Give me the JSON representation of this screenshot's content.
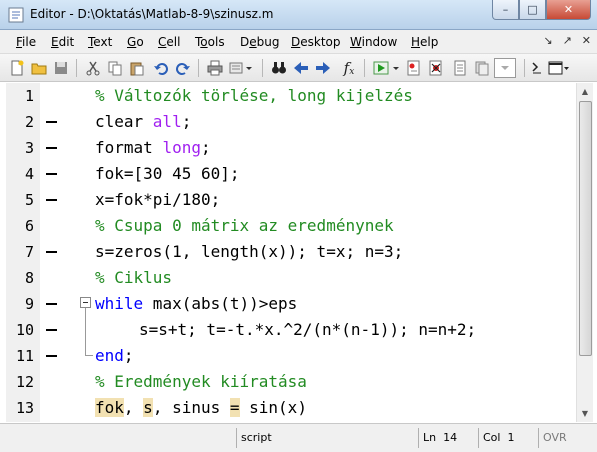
{
  "window": {
    "title": "Editor - D:\\Oktatás\\Matlab-8-9\\szinusz.m",
    "buttons": {
      "minimize": "–",
      "maximize": "□",
      "close": "✕"
    }
  },
  "menubar": {
    "items": [
      {
        "label": "File"
      },
      {
        "label": "Edit"
      },
      {
        "label": "Text"
      },
      {
        "label": "Go"
      },
      {
        "label": "Cell"
      },
      {
        "label": "Tools"
      },
      {
        "label": "Debug"
      },
      {
        "label": "Desktop"
      },
      {
        "label": "Window"
      },
      {
        "label": "Help"
      }
    ],
    "right_glyphs": [
      "↘",
      "↗",
      "✕"
    ]
  },
  "toolbar": {
    "icons": [
      "new-file-icon",
      "open-folder-icon",
      "save-icon",
      "cut-icon",
      "copy-icon",
      "paste-icon",
      "undo-icon",
      "redo-icon",
      "print-icon",
      "find-files-icon",
      "binoculars-icon",
      "back-icon",
      "forward-icon",
      "function-icon",
      "run-icon",
      "step-icon",
      "clear-breakpoints-icon",
      "stop-icon",
      "stack-icon",
      "dock-icon"
    ],
    "fx_label": "f",
    "fx_sub": "x"
  },
  "editor": {
    "lines": [
      {
        "n": "1",
        "dash": false,
        "segments": [
          {
            "t": "% Változók törlése, long kijelzés",
            "c": "comment"
          }
        ]
      },
      {
        "n": "2",
        "dash": true,
        "segments": [
          {
            "t": "clear ",
            "c": ""
          },
          {
            "t": "all",
            "c": "string"
          },
          {
            "t": ";",
            "c": ""
          }
        ]
      },
      {
        "n": "3",
        "dash": true,
        "segments": [
          {
            "t": "format ",
            "c": ""
          },
          {
            "t": "long",
            "c": "string"
          },
          {
            "t": ";",
            "c": ""
          }
        ]
      },
      {
        "n": "4",
        "dash": true,
        "segments": [
          {
            "t": "fok=[30 45 60];",
            "c": ""
          }
        ]
      },
      {
        "n": "5",
        "dash": true,
        "segments": [
          {
            "t": "x=fok*pi/180;",
            "c": ""
          }
        ]
      },
      {
        "n": "6",
        "dash": false,
        "segments": [
          {
            "t": "% Csupa 0 mátrix az eredménynek",
            "c": "comment"
          }
        ]
      },
      {
        "n": "7",
        "dash": true,
        "segments": [
          {
            "t": "s=zeros(1, length(x)); t=x; n=3;",
            "c": ""
          }
        ]
      },
      {
        "n": "8",
        "dash": false,
        "segments": [
          {
            "t": "% Ciklus",
            "c": "comment"
          }
        ]
      },
      {
        "n": "9",
        "dash": true,
        "segments": [
          {
            "t": "while",
            "c": "keyword"
          },
          {
            "t": " max(abs(t))>eps",
            "c": ""
          }
        ]
      },
      {
        "n": "10",
        "dash": true,
        "indent": true,
        "segments": [
          {
            "t": "s=s+t; t=-t.*x.^2/(n*(n-1)); n=n+2;",
            "c": ""
          }
        ]
      },
      {
        "n": "11",
        "dash": true,
        "segments": [
          {
            "t": "end",
            "c": "keyword"
          },
          {
            "t": ";",
            "c": ""
          }
        ]
      },
      {
        "n": "12",
        "dash": false,
        "segments": [
          {
            "t": "% Eredmények kiíratása",
            "c": "comment"
          }
        ]
      },
      {
        "n": "13",
        "dash": false,
        "segments": [
          {
            "t": "fok",
            "c": "hl"
          },
          {
            "t": ", ",
            "c": ""
          },
          {
            "t": "s",
            "c": "hl"
          },
          {
            "t": ", sinus ",
            "c": ""
          },
          {
            "t": "=",
            "c": "hl"
          },
          {
            "t": " sin(x)",
            "c": ""
          }
        ]
      }
    ]
  },
  "statusbar": {
    "mode": "script",
    "ln_label": "Ln",
    "ln_value": "14",
    "col_label": "Col",
    "col_value": "1",
    "ovr": "OVR"
  },
  "colors": {
    "comment": "#228b22",
    "keyword": "#0000ff",
    "string": "#a020f0",
    "highlight": "#f2e1b2"
  }
}
